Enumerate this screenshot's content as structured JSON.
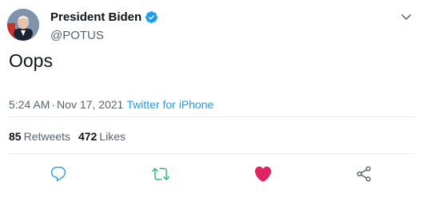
{
  "author": {
    "display_name": "President Biden",
    "handle": "@POTUS",
    "verified": true
  },
  "tweet": {
    "text": "Oops",
    "time": "5:24 AM",
    "separator": "·",
    "date": "Nov 17, 2021",
    "source": "Twitter for iPhone"
  },
  "stats": {
    "retweets_count": "85",
    "retweets_label": "Retweets",
    "likes_count": "472",
    "likes_label": "Likes"
  },
  "actions": {
    "reply_icon": "reply-icon",
    "retweet_icon": "retweet-icon",
    "like_icon": "heart-icon",
    "share_icon": "share-icon"
  },
  "colors": {
    "accent_blue": "#1d9bf0",
    "retweet_green": "#17bf63",
    "like_pink": "#e0245e",
    "muted_text": "#536471",
    "divider": "#e6ecf0"
  }
}
